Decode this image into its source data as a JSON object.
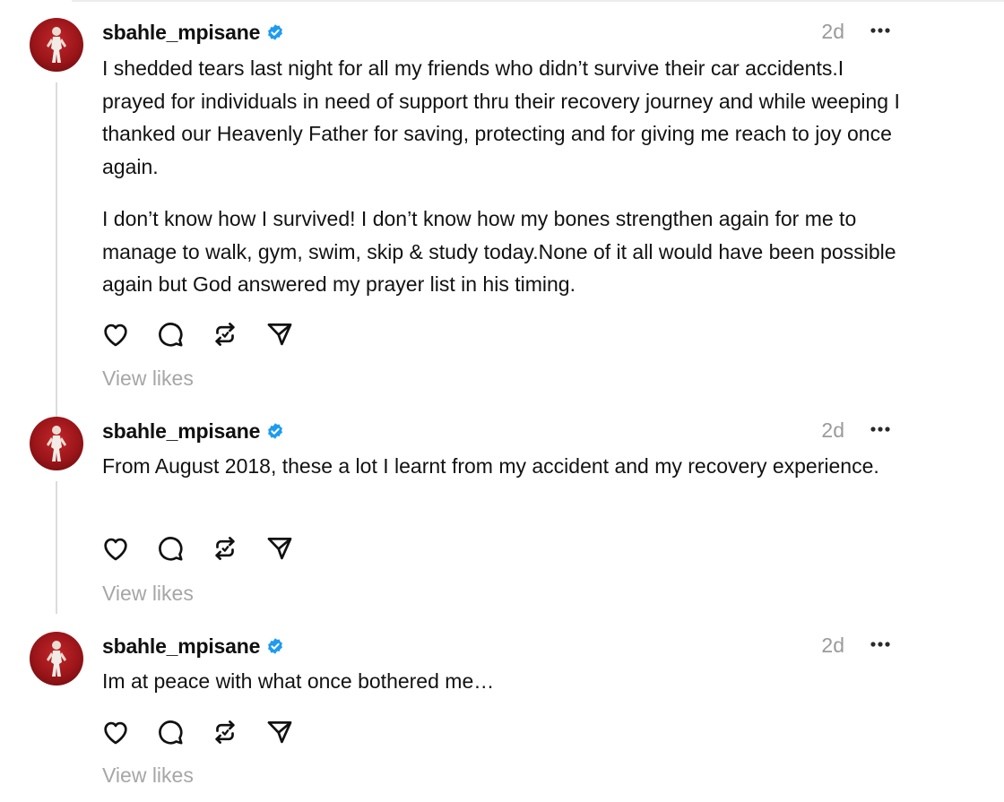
{
  "colors": {
    "text": "#101010",
    "muted": "#9a9a9a",
    "verified": "#1d9bf0",
    "avatar_bg": "#a3171b",
    "divider": "#dcdcdc"
  },
  "icons": {
    "avatar": "profile-photo",
    "verified": "verified-badge-icon",
    "more": "more-horizontal-icon",
    "like": "heart-icon",
    "comment": "comment-bubble-icon",
    "repost": "repost-icon",
    "share": "share-send-icon"
  },
  "posts": [
    {
      "username": "sbahle_mpisane",
      "time": "2d",
      "paragraphs": [
        "I shedded tears last night for all my friends who didn’t survive their car accidents.I prayed for individuals in need of support thru their recovery journey and while weeping I thanked our Heavenly Father for saving, protecting and for giving me reach to joy once again.",
        "I don’t know how I survived! I don’t know how my bones strengthen again for me to manage to walk, gym, swim, skip & study today.None of it all would have been possible again but God answered my prayer list in his timing."
      ],
      "view_likes": "View likes"
    },
    {
      "username": "sbahle_mpisane",
      "time": "2d",
      "paragraphs": [
        "From August 2018, these a lot I learnt from my accident and my recovery experience."
      ],
      "view_likes": "View likes"
    },
    {
      "username": "sbahle_mpisane",
      "time": "2d",
      "paragraphs": [
        "Im at peace with what once bothered me…"
      ],
      "view_likes": "View likes"
    }
  ]
}
